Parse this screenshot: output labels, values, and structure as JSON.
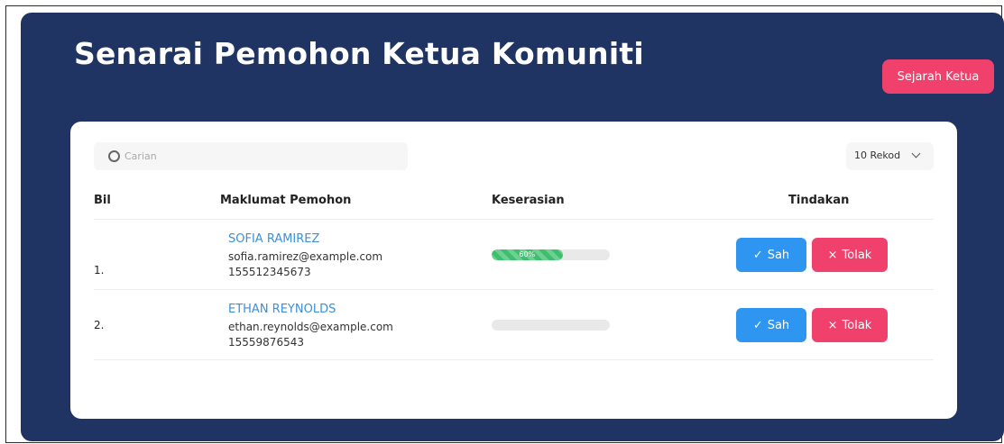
{
  "page": {
    "title": "Senarai Pemohon Ketua Komuniti",
    "history_button": "Sejarah Ketua"
  },
  "toolbar": {
    "search_placeholder": "Carian",
    "records_per_page": "10 Rekod"
  },
  "table": {
    "headers": {
      "number": "Bil",
      "applicant_info": "Maklumat Pemohon",
      "compatibility": "Keserasian",
      "actions": "Tindakan"
    },
    "rows": [
      {
        "number": "1.",
        "name": "SOFIA RAMIREZ",
        "email": "sofia.ramirez@example.com",
        "phone": "155512345673",
        "compatibility_percent": 60,
        "compatibility_label": "60%",
        "approve_label": "Sah",
        "reject_label": "Tolak"
      },
      {
        "number": "2.",
        "name": "ETHAN REYNOLDS",
        "email": "ethan.reynolds@example.com",
        "phone": "15559876543",
        "compatibility_percent": 0,
        "compatibility_label": "",
        "approve_label": "Sah",
        "reject_label": "Tolak"
      }
    ]
  },
  "icons": {
    "search": "search-icon",
    "dropdown": "chevron-down-icon",
    "approve": "check-icon",
    "reject": "close-icon"
  },
  "colors": {
    "panel_background": "#1f3462",
    "accent_pink": "#f0406c",
    "accent_blue": "#2e95f0",
    "progress_green": "#3dbf6e",
    "name_link": "#3d8fd6"
  }
}
